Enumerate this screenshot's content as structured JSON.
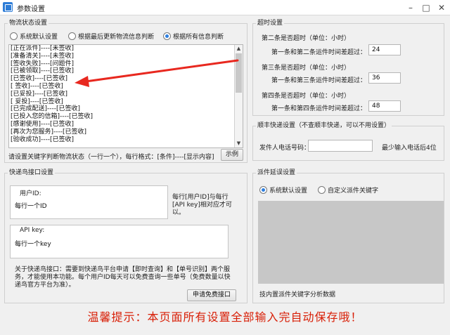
{
  "window": {
    "title": "参数设置"
  },
  "logistics_status": {
    "title": "物流状态设置",
    "options": [
      "系统默认设置",
      "根据最后更新物流信息判断",
      "根据所有信息判断"
    ],
    "selected_index": 2,
    "rules": [
      "[正在派件]----[未签收]",
      "[准备清关]----[未签收]",
      "[签收失败]----[问题件]",
      "[已被领取]----[已签收]",
      "[已签收]----[已签收]",
      "[ 签收]----[已签收]",
      "[已妥投]----[已签收]",
      "[ 妥投]----[已签收]",
      "[已完成配送]----[已签收]",
      "[已投入您的信箱]----[已签收]",
      "[感谢使用]----[已签收]",
      "[再次为您服务]----[已签收]",
      "[验收成功]----[已签收]"
    ],
    "hint": "请设置关键字判断物流状态（一行一个），每行格式：[条件]----[显示内容]",
    "example_button": "示例"
  },
  "timeout": {
    "title": "超时设置",
    "rows": [
      {
        "heading": "第二条是否超时（单位：小时）",
        "label": "第一条和第二条运件时间差超过：",
        "value": "24"
      },
      {
        "heading": "第三条是否超时（单位：小时）",
        "label": "第一条和第三条运件时间差超过：",
        "value": "36"
      },
      {
        "heading": "第四条是否超时（单位：小时）",
        "label": "第一条和第四条运件时间差超过：",
        "value": "48"
      }
    ]
  },
  "sf_express": {
    "title": "顺丰快递设置（不查顺丰快递，可以不用设置）",
    "phone_label": "发件人电话号码：",
    "phone_value": "",
    "phone_hint": "最少输入电话后4位"
  },
  "kdniao": {
    "title": "快递鸟接口设置",
    "user_id_label": "用户ID:",
    "user_id_placeholder": "每行一个ID",
    "api_key_label": "API key:",
    "api_key_placeholder": "每行一个key",
    "pair_note": "每行[用户ID]与每行[API key]相对应才可以。",
    "about": "关于快递鸟接口：需要到快递鸟平台申请【即时查询】和【单号识别】两个服务，才能使用本功能。每个用户ID每天可以免费查询一些单号（免费数量以快递鸟官方平台为准）。",
    "apply_button": "申请免费接口"
  },
  "dispatch_delay": {
    "title": "派件延误设置",
    "options": [
      "系统默认设置",
      "自定义派件关键字"
    ],
    "selected_index": 0,
    "footer": "技内置派件关键字分析数据"
  },
  "warm_tip": "温馨提示：本页面所有设置全部输入完自动保存哦！",
  "colors": {
    "accent_red": "#d81e06",
    "accent_green": "#2f8a1e",
    "radio_blue": "#2d7fe0"
  },
  "icons": {
    "arrow": "red-arrow-icon"
  }
}
